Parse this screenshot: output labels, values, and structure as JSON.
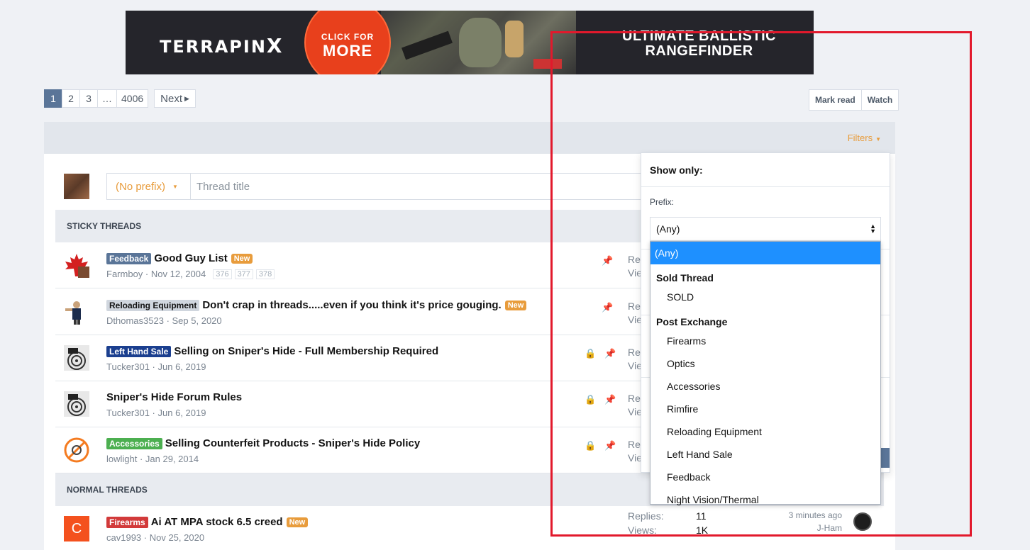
{
  "banner": {
    "brand": "TERRAPIN",
    "brand_x": "X",
    "cta_line1": "CLICK FOR",
    "cta_line2": "MORE",
    "slogan_line1": "ULTIMATE BALLISTIC",
    "slogan_line2": "RANGEFINDER"
  },
  "pagination": {
    "pages": [
      "1",
      "2",
      "3",
      "…",
      "4006"
    ],
    "active": "1",
    "next_label": "Next"
  },
  "actions": {
    "mark_read": "Mark read",
    "watch": "Watch"
  },
  "filters_label": "Filters",
  "new_thread": {
    "prefix": "(No prefix)",
    "title_placeholder": "Thread title"
  },
  "sections": {
    "sticky": "STICKY THREADS",
    "normal": "NORMAL THREADS"
  },
  "threads": [
    {
      "label": "Feedback",
      "label_color": "#5a7598",
      "title": "Good Guy List",
      "is_new": "New",
      "author": "Farmboy",
      "date": "Nov 12, 2004",
      "pages": [
        "376",
        "377",
        "378"
      ],
      "locked": false,
      "stat": "Rep",
      "stat2": "Vie"
    },
    {
      "label": "Reloading Equipment",
      "label_color": "#d0d6de",
      "title": "Don't crap in threads.....even if you think it's price gouging.",
      "is_new": "New",
      "author": "Dthomas3523",
      "date": "Sep 5, 2020",
      "locked": false,
      "stat": "Rep",
      "stat2": "Vie"
    },
    {
      "label": "Left Hand Sale",
      "label_color": "#1b3f8f",
      "title": "Selling on Sniper's Hide - Full Membership Required",
      "author": "Tucker301",
      "date": "Jun 6, 2019",
      "locked": true,
      "stat": "Rep",
      "stat2": "Vie"
    },
    {
      "label": "",
      "title": "Sniper's Hide Forum Rules",
      "author": "Tucker301",
      "date": "Jun 6, 2019",
      "locked": true,
      "stat": "Rep",
      "stat2": "Vie"
    },
    {
      "label": "Accessories",
      "label_color": "#4caf50",
      "title": "Selling Counterfeit Products - Sniper's Hide Policy",
      "author": "lowlight",
      "date": "Jan 29, 2014",
      "locked": true,
      "stat": "Rep",
      "stat2": "Vie"
    }
  ],
  "normal_thread": {
    "avatar_letter": "C",
    "label": "Firearms",
    "label_color": "#d23a3a",
    "title": "Ai AT MPA stock 6.5 creed",
    "is_new": "New",
    "author": "cav1993",
    "date": "Nov 25, 2020",
    "replies_label": "Replies:",
    "replies": "11",
    "views_label": "Views:",
    "views": "1K",
    "last_time": "3 minutes ago",
    "last_user": "J-Ham"
  },
  "popup": {
    "heading": "Show only:",
    "prefix_label": "Prefix:",
    "selected": "(Any)"
  },
  "dropdown": {
    "any": "(Any)",
    "group1": "Sold Thread",
    "group1_items": [
      "SOLD"
    ],
    "group2": "Post Exchange",
    "group2_items": [
      "Firearms",
      "Optics",
      "Accessories",
      "Rimfire",
      "Reloading Equipment",
      "Left Hand Sale",
      "Feedback",
      "Night Vision/Thermal"
    ]
  },
  "colors": {
    "accent": "#e89c3c",
    "primary": "#5a7598",
    "highlight": "#1e90ff",
    "annotation": "#e2192c"
  }
}
